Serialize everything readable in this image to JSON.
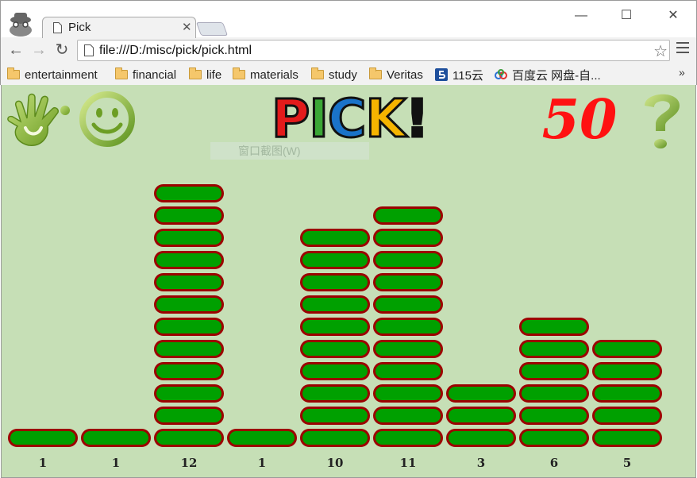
{
  "browser": {
    "tab_title": "Pick",
    "tab_close": "✕",
    "url": "file:///D:/misc/pick/pick.html",
    "window_controls": {
      "minimize": "—",
      "maximize": "☐",
      "close": "✕"
    },
    "nav": {
      "back": "←",
      "forward": "→",
      "reload": "↻"
    },
    "star": "☆",
    "bookmarks_more": "»",
    "bookmarks": [
      {
        "label": "entertainment",
        "icon": "folder-icon"
      },
      {
        "label": "financial",
        "icon": "folder-icon"
      },
      {
        "label": "life",
        "icon": "folder-icon"
      },
      {
        "label": "materials",
        "icon": "folder-icon"
      },
      {
        "label": "study",
        "icon": "folder-icon"
      },
      {
        "label": "Veritas",
        "icon": "folder-icon"
      },
      {
        "label": "115云",
        "icon": "115-icon"
      },
      {
        "label": "百度云 网盘-自...",
        "icon": "baidu-cloud-icon"
      }
    ]
  },
  "game": {
    "logo_letters": [
      {
        "char": "P",
        "color": "#e31b1b"
      },
      {
        "char": "I",
        "color": "#3aa635"
      },
      {
        "char": "C",
        "color": "#1a73c9"
      },
      {
        "char": "K",
        "color": "#f5b400"
      },
      {
        "char": "!",
        "color": "#111111"
      }
    ],
    "score": "50",
    "tooltip": "窗口截图(W)",
    "stone_color": "#00a000",
    "stone_border_color": "#9c0000",
    "columns": [
      {
        "count": 1,
        "label": "1"
      },
      {
        "count": 1,
        "label": "1"
      },
      {
        "count": 12,
        "label": "12"
      },
      {
        "count": 1,
        "label": "1"
      },
      {
        "count": 10,
        "label": "10"
      },
      {
        "count": 11,
        "label": "11"
      },
      {
        "count": 3,
        "label": "3"
      },
      {
        "count": 6,
        "label": "6"
      },
      {
        "count": 5,
        "label": "5"
      }
    ]
  }
}
